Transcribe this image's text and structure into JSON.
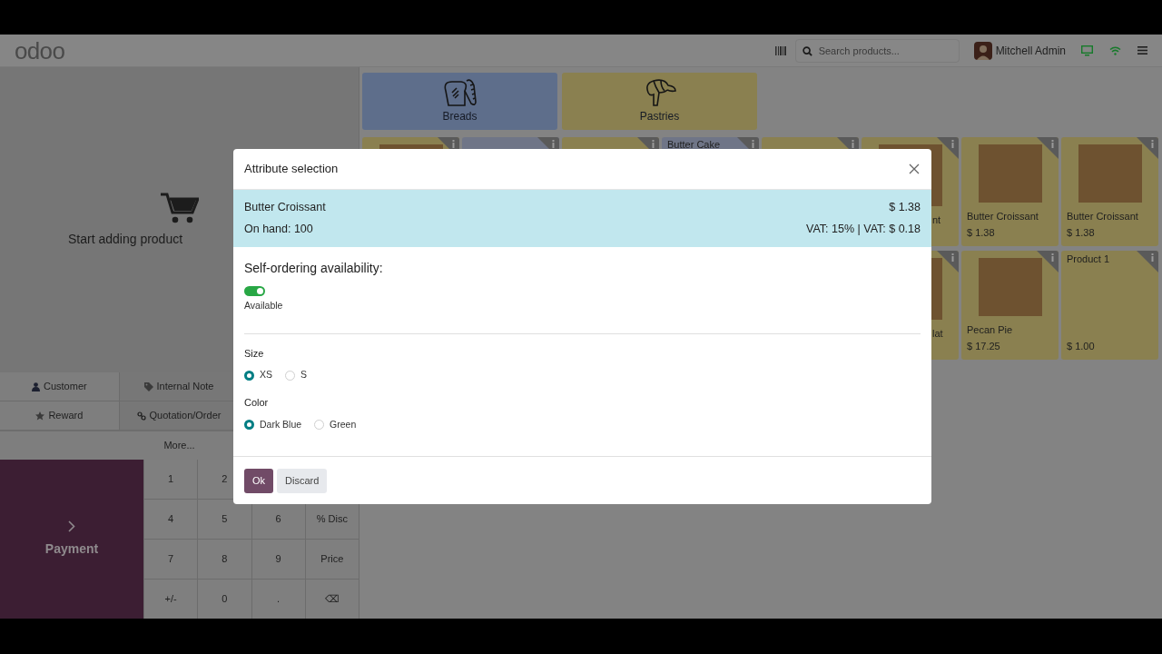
{
  "navbar": {
    "logo": "odoo",
    "search": {
      "placeholder": "Search products..."
    },
    "user": "Mitchell Admin"
  },
  "order_panel": {
    "empty_message": "Start adding product",
    "actions": [
      "Customer",
      "Internal Note",
      "Reward",
      "Quotation/Order"
    ],
    "more": "More...",
    "payment": "Payment",
    "numpad": [
      [
        "1",
        "2"
      ],
      [
        "4",
        "5",
        "6",
        "% Disc"
      ],
      [
        "7",
        "8",
        "9",
        "Price"
      ],
      [
        "+/-",
        "0",
        ".",
        "⌫"
      ]
    ]
  },
  "categories": [
    {
      "label": "Breads",
      "color": "#5e6e8b"
    },
    {
      "label": "Pastries",
      "color": "#8a8050"
    }
  ],
  "products": [
    {
      "color": "#8a8050",
      "photo": true
    },
    {
      "color": "#6f7587",
      "photo": false
    },
    {
      "color": "#8a8050",
      "photo": false
    },
    {
      "color": "#6f7587",
      "photo": false,
      "name": "Butter Cake"
    },
    {
      "color": "#8a8050",
      "photo": false
    },
    {
      "color": "#8a8050",
      "photo": true,
      "name": "nt"
    },
    {
      "color": "#8a8050",
      "photo": true,
      "name": "Butter Croissant",
      "price": "$ 1.38"
    },
    {
      "color": "#8a8050",
      "photo": true,
      "name": "Butter Croissant",
      "price": "$ 1.38"
    },
    {
      "color": "#8a8050",
      "photo": true,
      "name": "lat"
    },
    {
      "color": "#8a8050",
      "photo": true,
      "name": "Pecan Pie",
      "price": "$ 17.25"
    },
    {
      "color": "#8a8050",
      "photo": false,
      "name": "Product 1",
      "price": "$ 1.00"
    }
  ],
  "dialog": {
    "title": "Attribute selection",
    "product": "Butter Croissant",
    "price": "$ 1.38",
    "on_hand": "On hand: 100",
    "tax": "VAT: 15% | VAT: $ 0.18",
    "availability": {
      "heading": "Self-ordering availability:",
      "on": true,
      "label": "Available"
    },
    "attributes": [
      {
        "name": "Size",
        "options": [
          {
            "label": "XS",
            "selected": true
          },
          {
            "label": "S",
            "selected": false
          }
        ]
      },
      {
        "name": "Color",
        "options": [
          {
            "label": "Dark Blue",
            "selected": true
          },
          {
            "label": "Green",
            "selected": false
          }
        ]
      }
    ],
    "buttons": [
      {
        "label": "Ok",
        "kind": "primary"
      },
      {
        "label": "Discard",
        "kind": "secondary"
      }
    ]
  }
}
